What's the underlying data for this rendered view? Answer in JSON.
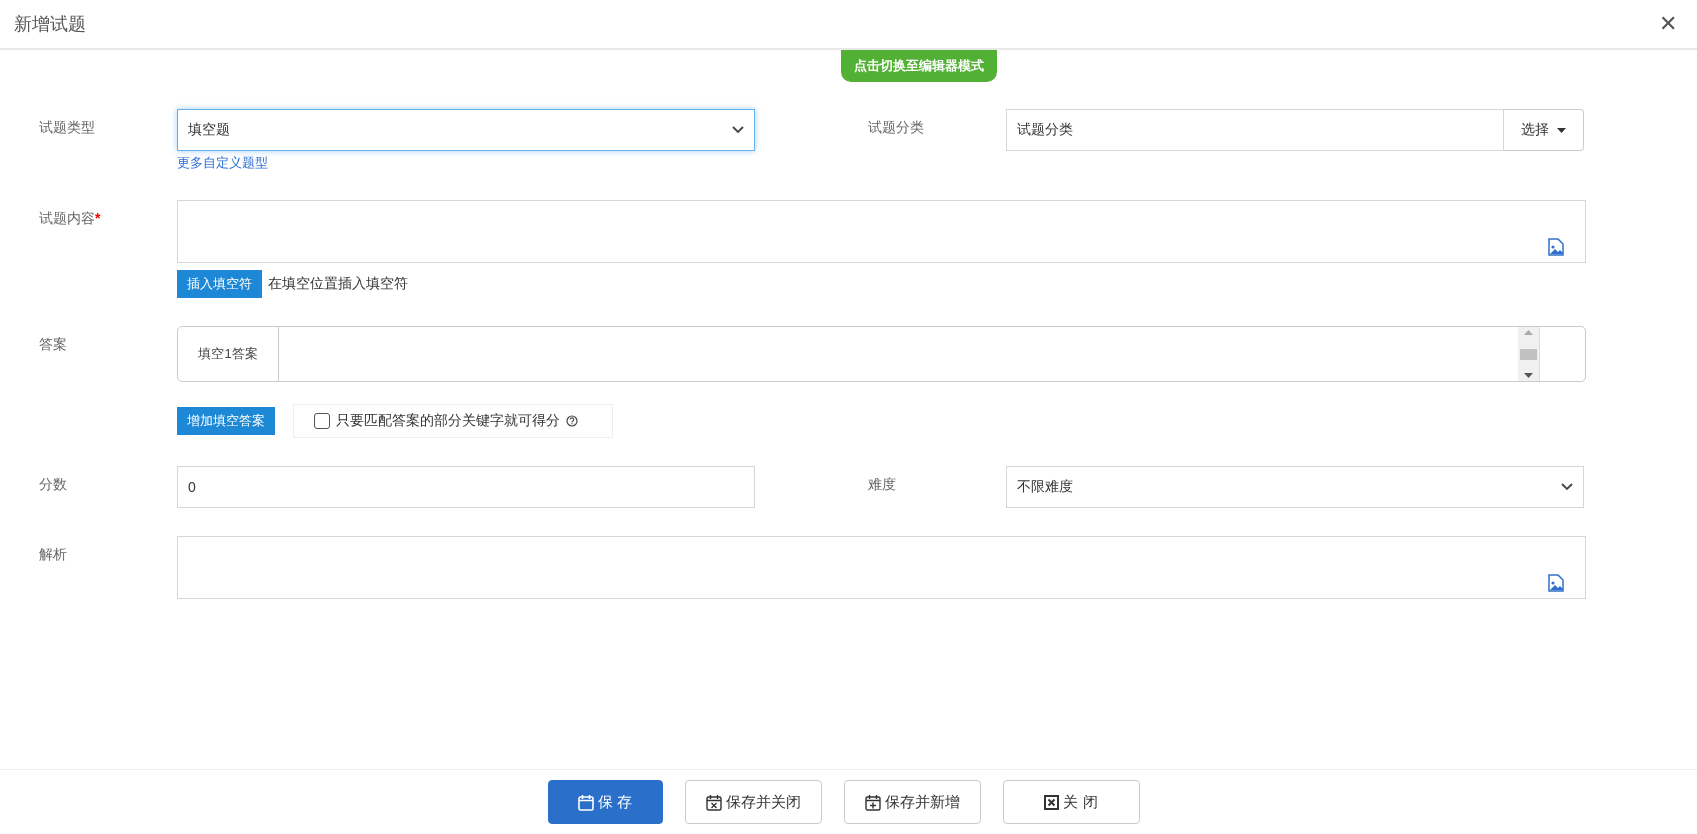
{
  "window": {
    "title": "新增试题",
    "close": "✕"
  },
  "mode_switch": "点击切换至编辑器模式",
  "question_type": {
    "label": "试题类型",
    "value": "填空题",
    "link": "更多自定义题型"
  },
  "category": {
    "label": "试题分类",
    "value": "试题分类",
    "button": "选择"
  },
  "content": {
    "label": "试题内容",
    "required_mark": "*",
    "insert_button": "插入填空符",
    "hint": "在填空位置插入填空符"
  },
  "answer": {
    "label": "答案",
    "blanks": [
      {
        "label": "填空1答案"
      }
    ],
    "add_button": "增加填空答案",
    "partial_match": {
      "label": "只要匹配答案的部分关键字就可得分",
      "checked": false
    }
  },
  "score": {
    "label": "分数",
    "value": "0"
  },
  "difficulty": {
    "label": "难度",
    "value": "不限难度"
  },
  "analysis": {
    "label": "解析"
  },
  "footer_buttons": [
    {
      "label": "保 存",
      "kind": "calendar",
      "primary": true
    },
    {
      "label": "保存并关闭",
      "kind": "calendar-x",
      "primary": false
    },
    {
      "label": "保存并新增",
      "kind": "calendar-plus",
      "primary": false
    },
    {
      "label": "关 闭",
      "kind": "close-box",
      "primary": false
    }
  ]
}
